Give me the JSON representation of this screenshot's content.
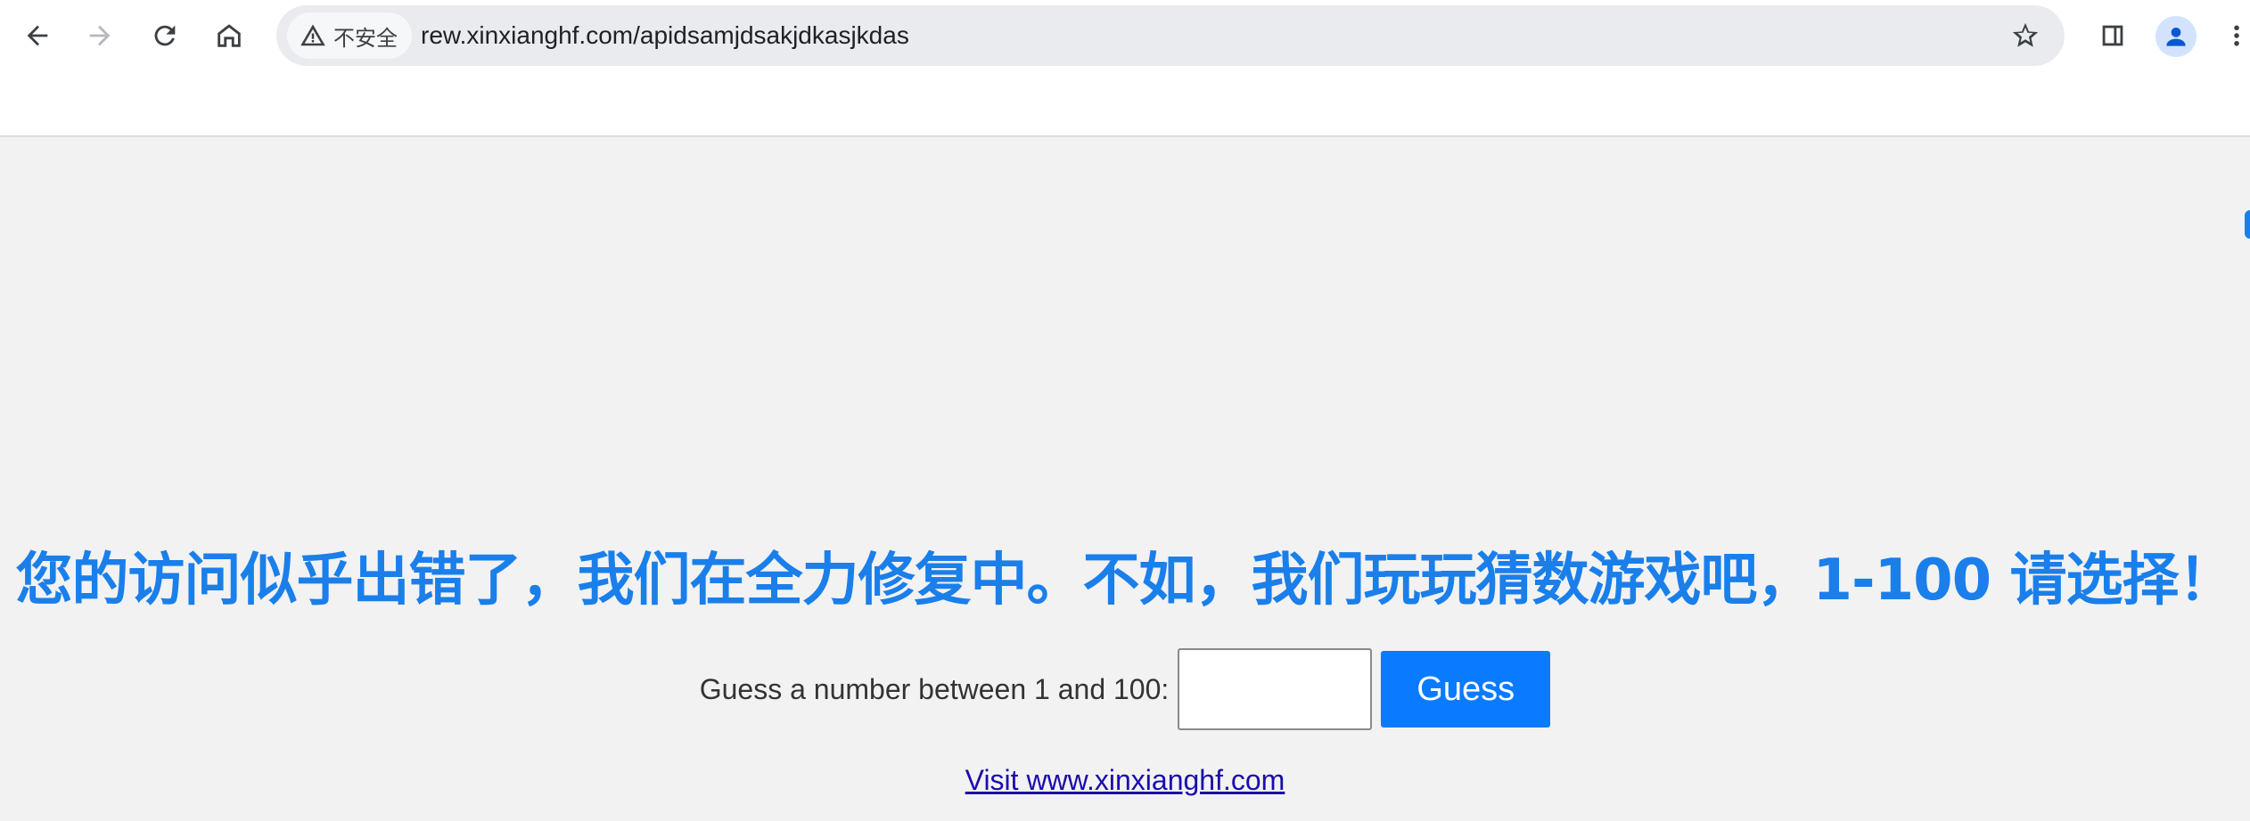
{
  "browser": {
    "back_icon": "arrow-left-icon",
    "forward_icon": "arrow-right-icon",
    "reload_icon": "reload-icon",
    "home_icon": "home-icon",
    "security_label": "不安全",
    "url": "rew.xinxianghf.com/apidsamjdsakjdkasjkdas",
    "bookmark_icon": "star-icon",
    "side_panel_icon": "side-panel-icon",
    "profile_icon": "profile-icon",
    "menu_icon": "kebab-menu-icon"
  },
  "page": {
    "headline": "您的访问似乎出错了，我们在全力修复中。不如，我们玩玩猜数游戏吧，1-100 请选择！",
    "guess_label": "Guess a number between 1 and 100:",
    "guess_input_value": "",
    "guess_button": "Guess",
    "visit_link": "Visit www.xinxianghf.com"
  },
  "colors": {
    "headline": "#1a7fea",
    "button": "#0a7bff",
    "link": "#1a0dab",
    "page_background": "#f2f2f2"
  }
}
